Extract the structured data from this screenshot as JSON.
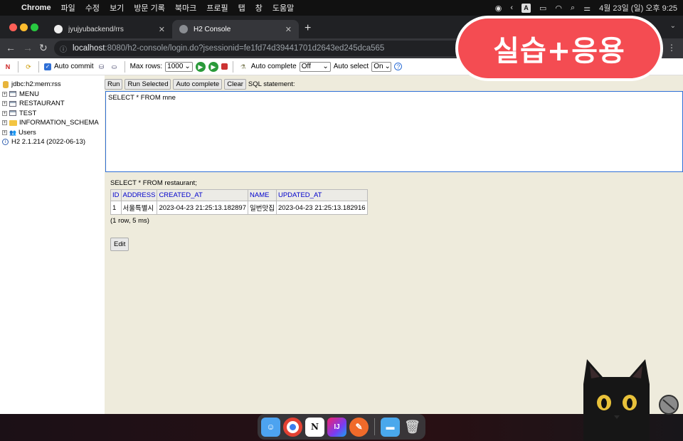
{
  "menubar": {
    "app_name": "Chrome",
    "items": [
      "파일",
      "수정",
      "보기",
      "방문 기록",
      "북마크",
      "프로필",
      "탭",
      "창",
      "도움말"
    ],
    "datetime": "4월 23일 (일) 오후 9:25",
    "input_source": "A"
  },
  "tabs": [
    {
      "label": "jyujyubackend/rrs",
      "active": false
    },
    {
      "label": "H2 Console",
      "active": true
    }
  ],
  "address": {
    "host": "localhost",
    "path": ":8080/h2-console/login.do?jsessionid=fe1fd74d39441701d2643ed245dca565"
  },
  "h2toolbar": {
    "auto_commit_label": "Auto commit",
    "max_rows_label": "Max rows:",
    "max_rows_value": "1000",
    "auto_complete_label": "Auto complete",
    "auto_complete_value": "Off",
    "auto_select_label": "Auto select",
    "auto_select_value": "On"
  },
  "tree": {
    "connection": "jdbc:h2:mem:rss",
    "tables": [
      "MENU",
      "RESTAURANT",
      "TEST"
    ],
    "schema": "INFORMATION_SCHEMA",
    "users": "Users",
    "version": "H2 2.1.214 (2022-06-13)"
  },
  "sql_buttons": {
    "run": "Run",
    "run_selected": "Run Selected",
    "auto_complete": "Auto complete",
    "clear": "Clear",
    "statement_label": "SQL statement:"
  },
  "editor": {
    "text": "SELECT * FROM mne"
  },
  "result": {
    "query": "SELECT * FROM restaurant;",
    "columns": [
      "ID",
      "ADDRESS",
      "CREATED_AT",
      "NAME",
      "UPDATED_AT"
    ],
    "rows": [
      [
        "1",
        "서울특별시",
        "2023-04-23 21:25:13.182897",
        "일번맛집",
        "2023-04-23 21:25:13.182916"
      ]
    ],
    "summary": "(1 row, 5 ms)",
    "edit_label": "Edit"
  },
  "badge": {
    "text": "실습+응용",
    "color": "#f44c52"
  },
  "dock": {
    "apps": [
      "finder-icon",
      "chrome-icon",
      "notion-icon",
      "intellij-icon",
      "postman-icon",
      "folder-icon",
      "trash-icon"
    ]
  },
  "colors": {
    "panel_bg": "#eeebdc",
    "editor_border": "#2f6fd6",
    "column_header_text": "#0000cc"
  }
}
